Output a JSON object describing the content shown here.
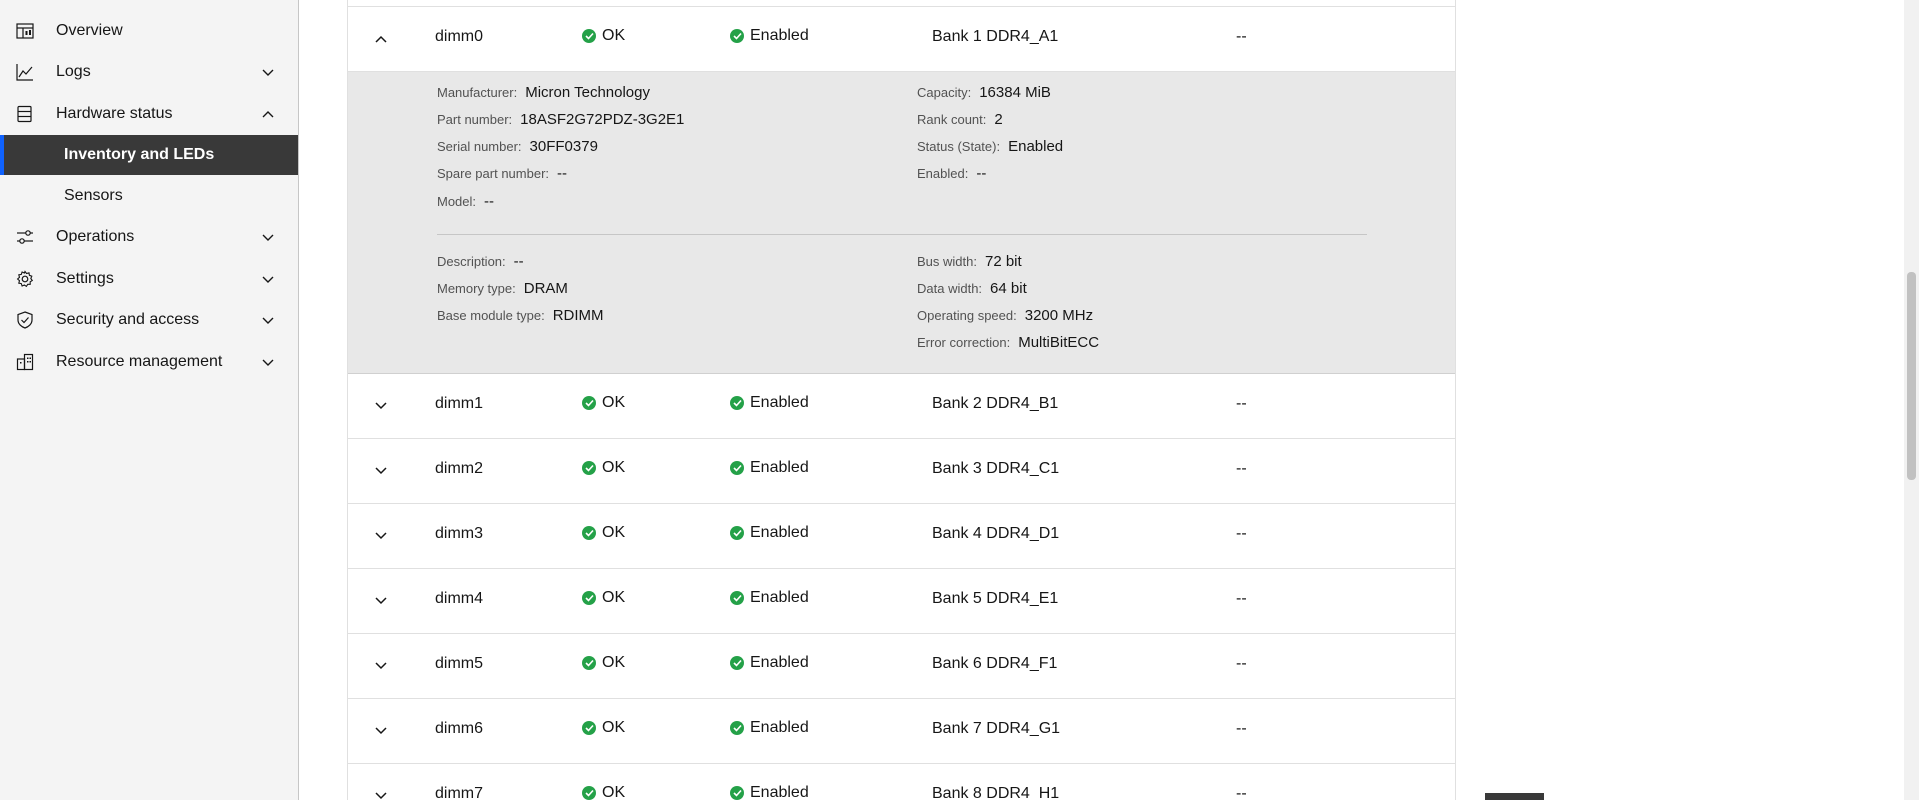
{
  "sidebar": {
    "items": [
      {
        "label": "Overview",
        "icon": "dashboard-icon",
        "chevron": ""
      },
      {
        "label": "Logs",
        "icon": "chart-line-icon",
        "chevron": "down"
      },
      {
        "label": "Hardware status",
        "icon": "data-base-icon",
        "chevron": "up"
      },
      {
        "label": "Operations",
        "icon": "sliders-icon",
        "chevron": "down"
      },
      {
        "label": "Settings",
        "icon": "gear-icon",
        "chevron": "down"
      },
      {
        "label": "Security and access",
        "icon": "shield-check-icon",
        "chevron": "down"
      },
      {
        "label": "Resource management",
        "icon": "building-icon",
        "chevron": "down"
      }
    ],
    "sub_items": [
      {
        "label": "Inventory and LEDs",
        "active": true
      },
      {
        "label": "Sensors",
        "active": false
      }
    ]
  },
  "table": {
    "rows": [
      {
        "name": "dimm0",
        "health": "OK",
        "state": "Enabled",
        "location": "Bank 1 DDR4_A1",
        "led": "--",
        "expanded": true
      },
      {
        "name": "dimm1",
        "health": "OK",
        "state": "Enabled",
        "location": "Bank 2 DDR4_B1",
        "led": "--",
        "expanded": false
      },
      {
        "name": "dimm2",
        "health": "OK",
        "state": "Enabled",
        "location": "Bank 3 DDR4_C1",
        "led": "--",
        "expanded": false
      },
      {
        "name": "dimm3",
        "health": "OK",
        "state": "Enabled",
        "location": "Bank 4 DDR4_D1",
        "led": "--",
        "expanded": false
      },
      {
        "name": "dimm4",
        "health": "OK",
        "state": "Enabled",
        "location": "Bank 5 DDR4_E1",
        "led": "--",
        "expanded": false
      },
      {
        "name": "dimm5",
        "health": "OK",
        "state": "Enabled",
        "location": "Bank 6 DDR4_F1",
        "led": "--",
        "expanded": false
      },
      {
        "name": "dimm6",
        "health": "OK",
        "state": "Enabled",
        "location": "Bank 7 DDR4_G1",
        "led": "--",
        "expanded": false
      },
      {
        "name": "dimm7",
        "health": "OK",
        "state": "Enabled",
        "location": "Bank 8 DDR4_H1",
        "led": "--",
        "expanded": false
      }
    ],
    "detail": {
      "left_top": [
        {
          "key": "Manufacturer:",
          "value": "Micron Technology"
        },
        {
          "key": "Part number:",
          "value": "18ASF2G72PDZ-3G2E1"
        },
        {
          "key": "Serial number:",
          "value": "30FF0379"
        },
        {
          "key": "Spare part number:",
          "value": "--"
        },
        {
          "key": "Model:",
          "value": "--"
        }
      ],
      "right_top": [
        {
          "key": "Capacity:",
          "value": "16384 MiB"
        },
        {
          "key": "Rank count:",
          "value": "2"
        },
        {
          "key": "Status (State):",
          "value": "Enabled"
        },
        {
          "key": "Enabled:",
          "value": "--"
        }
      ],
      "left_bottom": [
        {
          "key": "Description:",
          "value": "--"
        },
        {
          "key": "Memory type:",
          "value": "DRAM"
        },
        {
          "key": "Base module type:",
          "value": "RDIMM"
        }
      ],
      "right_bottom": [
        {
          "key": "Bus width:",
          "value": "72 bit"
        },
        {
          "key": "Data width:",
          "value": "64 bit"
        },
        {
          "key": "Operating speed:",
          "value": "3200 MHz"
        },
        {
          "key": "Error correction:",
          "value": "MultiBitECC"
        }
      ]
    }
  },
  "colors": {
    "status_ok": "#24a148",
    "active_nav_bg": "#393939",
    "active_nav_accent": "#0f62fe",
    "detail_bg": "#e8e8e8"
  }
}
